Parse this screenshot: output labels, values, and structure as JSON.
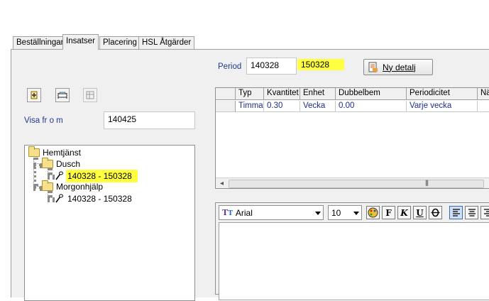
{
  "tabs": [
    {
      "label": "Beställningar"
    },
    {
      "label": "Insatser"
    },
    {
      "label": "Placering"
    },
    {
      "label": "HSL Åtgärder"
    }
  ],
  "period": {
    "label": "Period",
    "from": "140328",
    "to": "150328"
  },
  "new_detail_button": {
    "label": "Ny detalj"
  },
  "visa": {
    "label": "Visa fr o m",
    "value": "140425"
  },
  "tree": {
    "root": "Hemtjänst",
    "children": [
      {
        "label": "Dusch",
        "items": [
          "140328 - 150328"
        ]
      },
      {
        "label": "Morgonhjälp",
        "items": [
          "140328 - 150328"
        ]
      }
    ]
  },
  "grid": {
    "columns": [
      "Typ",
      "Kvantitet",
      "Enhet",
      "Dubbelbem",
      "Periodicitet",
      "Nä"
    ],
    "rows": [
      [
        "Timmar",
        "0.30",
        "Vecka",
        "0.00",
        "Varje vecka",
        ""
      ]
    ]
  },
  "editor": {
    "font": "Arial",
    "size": "10",
    "bold": "F",
    "italic": "K",
    "underline": "U"
  },
  "colors": {
    "highlight": "#ffff40",
    "link_blue": "#1f3a8f"
  }
}
